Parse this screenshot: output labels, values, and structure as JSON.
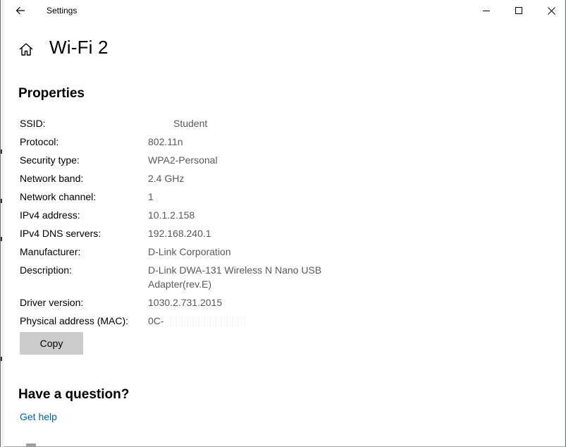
{
  "titlebar": {
    "app_title": "Settings",
    "back_icon": "back-arrow-icon",
    "minimize_icon": "minimize-icon",
    "maximize_icon": "maximize-icon",
    "close_icon": "close-icon"
  },
  "header": {
    "home_icon": "home-icon",
    "page_title": "Wi-Fi 2"
  },
  "properties": {
    "section_title": "Properties",
    "rows": [
      {
        "label": "SSID:",
        "value": "Student"
      },
      {
        "label": "Protocol:",
        "value": "802.11n"
      },
      {
        "label": "Security type:",
        "value": "WPA2-Personal"
      },
      {
        "label": "Network band:",
        "value": "2.4 GHz"
      },
      {
        "label": "Network channel:",
        "value": "1"
      },
      {
        "label": "IPv4 address:",
        "value": "10.1.2.158"
      },
      {
        "label": "IPv4 DNS servers:",
        "value": "192.168.240.1"
      },
      {
        "label": "Manufacturer:",
        "value": "D-Link Corporation"
      },
      {
        "label": "Description:",
        "value": "D-Link DWA-131 Wireless N Nano USB Adapter(rev.E)"
      },
      {
        "label": "Driver version:",
        "value": "1030.2.731.2015"
      },
      {
        "label": "Physical address (MAC):",
        "value": "0C-"
      }
    ],
    "copy_label": "Copy"
  },
  "help": {
    "title": "Have a question?",
    "link_label": "Get help"
  },
  "colors": {
    "link": "#0063b1",
    "button_bg": "#cccccc",
    "value_text": "#5a5a5a"
  }
}
